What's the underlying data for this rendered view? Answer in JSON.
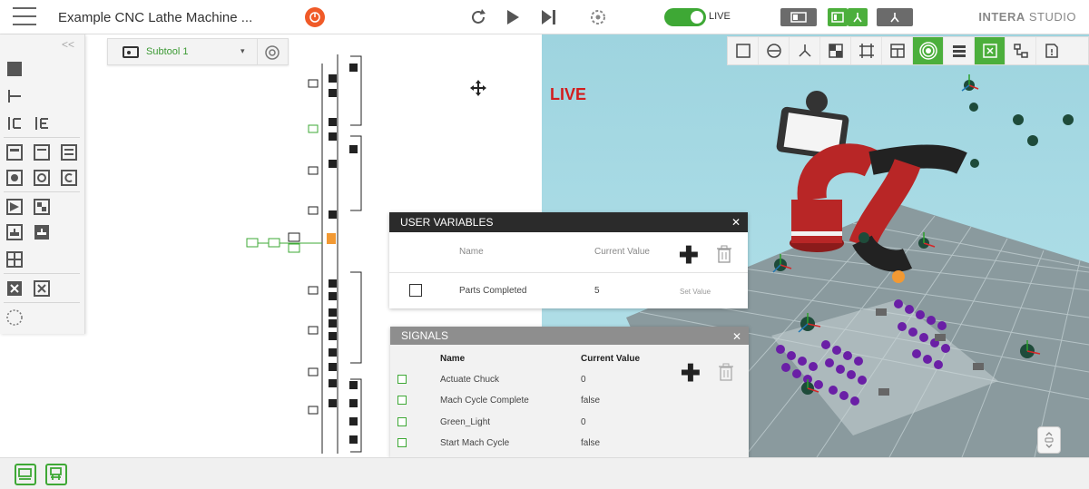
{
  "header": {
    "title": "Example CNC Lathe Machine ...",
    "live_toggle_label": "LIVE",
    "live_on": true,
    "brand_bold": "INTERA",
    "brand_light": "STUDIO"
  },
  "subtool": {
    "label": "Subtool 1"
  },
  "viewport": {
    "live_text": "LIVE"
  },
  "user_variables": {
    "title": "USER VARIABLES",
    "columns": {
      "name": "Name",
      "current_value": "Current Value"
    },
    "rows": [
      {
        "name": "Parts Completed",
        "value": "5",
        "action": "Set Value"
      }
    ]
  },
  "signals": {
    "title": "SIGNALS",
    "columns": {
      "name": "Name",
      "current_value": "Current Value"
    },
    "rows": [
      {
        "name": "Actuate Chuck",
        "value": "0"
      },
      {
        "name": "Mach Cycle Complete",
        "value": "false"
      },
      {
        "name": "Green_Light",
        "value": "0"
      },
      {
        "name": "Start Mach Cycle",
        "value": "false"
      }
    ]
  },
  "colors": {
    "accent_green": "#3ea835",
    "live_red": "#d21e1e",
    "alert_orange": "#f05a28",
    "panel_dark": "#2b2b2b"
  }
}
